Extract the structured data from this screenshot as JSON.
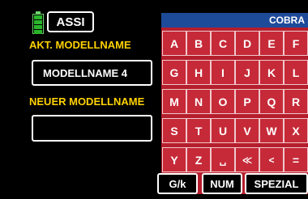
{
  "header": {
    "assi_label": "ASSI",
    "battery_icon": "battery-icon"
  },
  "current_model": {
    "label": "AKT. MODELLNAME",
    "value": "MODELLNAME 4"
  },
  "new_model": {
    "label": "NEUER MODELLNAME",
    "value": ""
  },
  "keyboard": {
    "title": "COBRA",
    "rows": [
      [
        "A",
        "B",
        "C",
        "D",
        "E",
        "F"
      ],
      [
        "G",
        "H",
        "I",
        "J",
        "K",
        "L"
      ],
      [
        "M",
        "N",
        "O",
        "P",
        "Q",
        "R"
      ],
      [
        "S",
        "T",
        "U",
        "V",
        "W",
        "X"
      ],
      [
        "Y",
        "Z",
        "␣",
        "≪",
        "<",
        "="
      ]
    ]
  },
  "bottom_buttons": {
    "case_toggle": "G/k",
    "num": "NUM",
    "special": "SPEZIAL"
  },
  "colors": {
    "screen_background": "#000000",
    "label_yellow": "#ffd200",
    "keyboard_red": "#c62a38",
    "keyboard_header_blue": "#1e4a9a",
    "battery_green": "#2ab52a"
  }
}
